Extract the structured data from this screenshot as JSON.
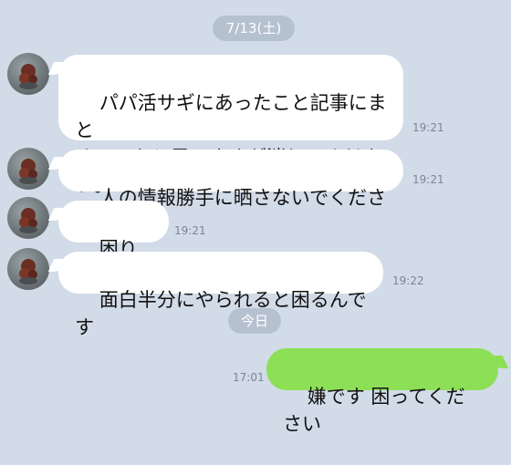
{
  "date_separators": {
    "first": "7/13(土)",
    "second": "今日"
  },
  "messages": [
    {
      "sender": "other",
      "text": "パパ活サギにあったこと記事にまと\nめていたと思いますが消してくださ\nい。",
      "time": "19:21"
    },
    {
      "sender": "other",
      "text": "人の情報勝手に晒さないでください",
      "time": "19:21"
    },
    {
      "sender": "other",
      "text": "困ります",
      "time": "19:21"
    },
    {
      "sender": "other",
      "text": "面白半分にやられると困るんです",
      "time": "19:22"
    },
    {
      "sender": "self",
      "text": "嫌です 困ってください",
      "time": "17:01"
    }
  ],
  "icons": {
    "avatar": "avatar-icon"
  }
}
